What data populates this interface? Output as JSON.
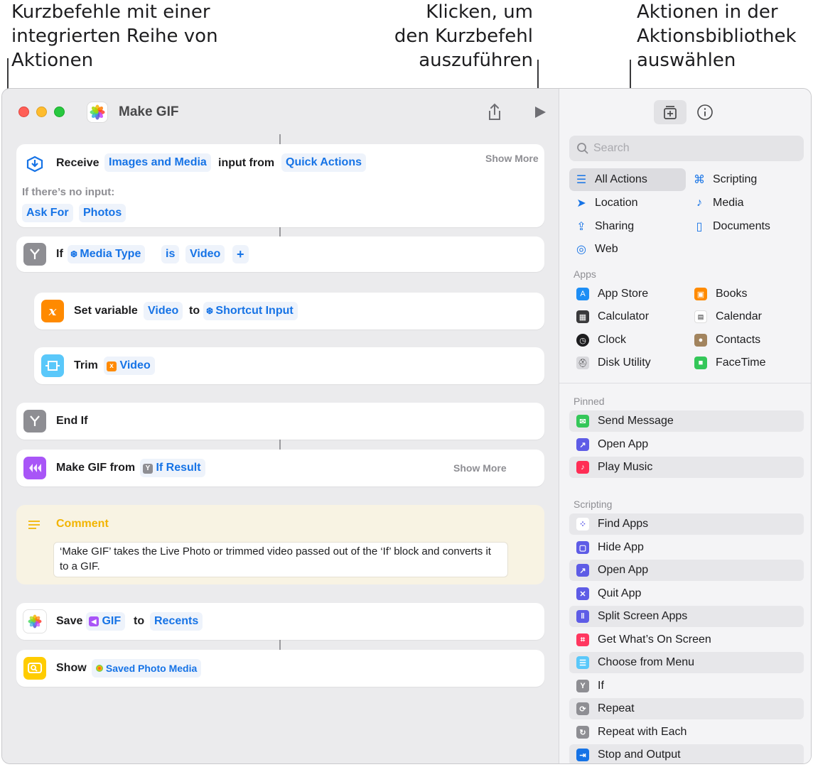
{
  "callouts": {
    "left": [
      "Kurzbefehle mit einer",
      "integrierten Reihe von",
      "Aktionen"
    ],
    "middle": [
      "Klicken, um",
      "den Kurzbefehl",
      "auszuführen"
    ],
    "right": [
      "Aktionen in der",
      "Aktionsbibliothek",
      "auswählen"
    ]
  },
  "window": {
    "title": "Make GIF"
  },
  "actions": {
    "receive": {
      "label": "Receive",
      "type": "Images and Media",
      "mid": "input from",
      "source": "Quick Actions",
      "show_more": "Show More",
      "no_input": "If there’s no input:",
      "ask_for": "Ask For",
      "photos": "Photos"
    },
    "if": {
      "label": "If",
      "var": "Media Type",
      "op": "is",
      "value": "Video",
      "add": "+"
    },
    "set_var": {
      "label": "Set variable",
      "name": "Video",
      "to": "to",
      "value": "Shortcut Input"
    },
    "trim": {
      "label": "Trim",
      "value": "Video"
    },
    "end_if": {
      "label": "End If"
    },
    "make_gif": {
      "label": "Make GIF from",
      "value": "If Result",
      "show_more": "Show More"
    },
    "comment": {
      "label": "Comment",
      "text": "‘Make GIF’ takes the Live Photo or trimmed video passed out of the ‘If’ block and converts it to a GIF."
    },
    "save": {
      "label": "Save",
      "value": "GIF",
      "to": "to",
      "dest": "Recents"
    },
    "show": {
      "label": "Show",
      "value": "Saved Photo Media"
    }
  },
  "sidebar": {
    "search_placeholder": "Search",
    "categories": [
      "All Actions",
      "Scripting",
      "Location",
      "Media",
      "Sharing",
      "Documents",
      "Web"
    ],
    "apps_header": "Apps",
    "apps": [
      "App Store",
      "Books",
      "Calculator",
      "Calendar",
      "Clock",
      "Contacts",
      "Disk Utility",
      "FaceTime"
    ],
    "pinned_header": "Pinned",
    "pinned": [
      "Send Message",
      "Open App",
      "Play Music"
    ],
    "scripting_header": "Scripting",
    "scripting": [
      "Find Apps",
      "Hide App",
      "Open App",
      "Quit App",
      "Split Screen Apps",
      "Get What’s On Screen",
      "Choose from Menu",
      "If",
      "Repeat",
      "Repeat with Each",
      "Stop and Output"
    ]
  },
  "colors": {
    "accent": "#1673e6",
    "editor_bg": "#ebebed",
    "sidebar_bg": "#f4f4f6",
    "comment_bg": "#f8f3e3",
    "comment_accent": "#f2b400"
  }
}
